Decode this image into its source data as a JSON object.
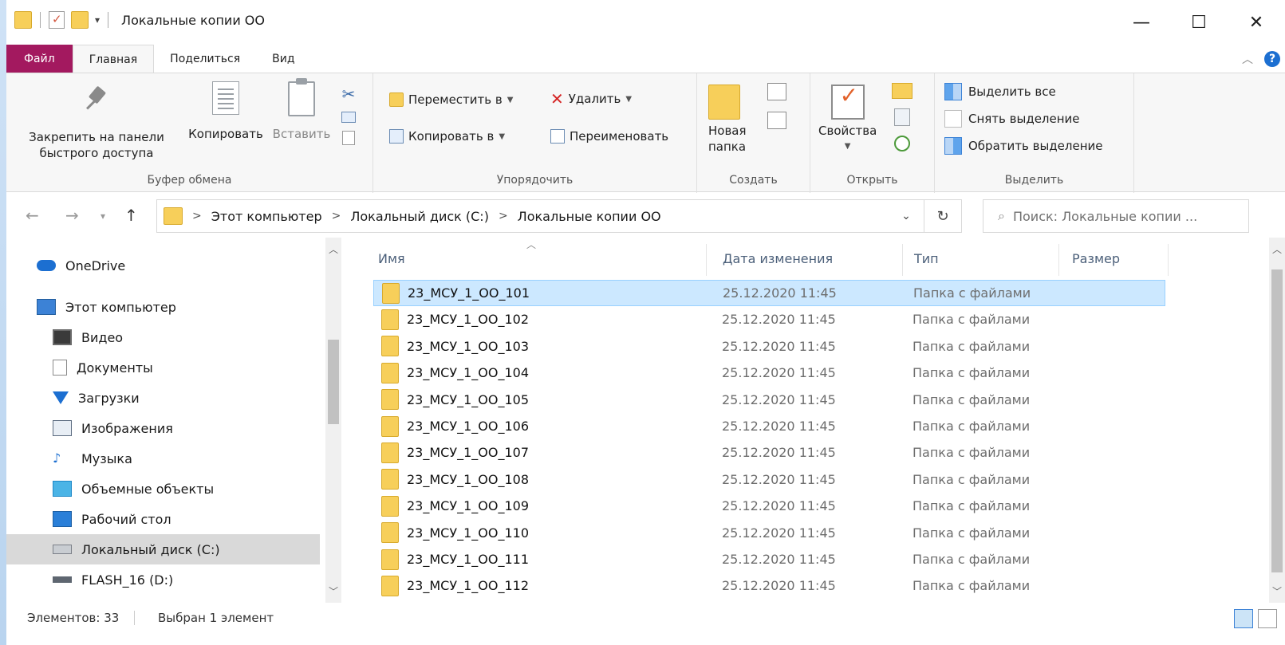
{
  "window": {
    "title": "Локальные копии ОО",
    "controls": {
      "minimize": "—",
      "maximize": "☐",
      "close": "✕"
    }
  },
  "ribbon_tabs": [
    "Файл",
    "Главная",
    "Поделиться",
    "Вид"
  ],
  "ribbon": {
    "clipboard": {
      "label": "Буфер обмена",
      "pin_line1": "Закрепить на панели",
      "pin_line2": "быстрого доступа",
      "copy": "Копировать",
      "paste": "Вставить"
    },
    "organize": {
      "label": "Упорядочить",
      "move_to": "Переместить в",
      "copy_to": "Копировать в",
      "delete": "Удалить",
      "rename": "Переименовать"
    },
    "create": {
      "label": "Создать",
      "new_folder_line1": "Новая",
      "new_folder_line2": "папка"
    },
    "open": {
      "label": "Открыть",
      "properties": "Свойства"
    },
    "select": {
      "label": "Выделить",
      "select_all": "Выделить все",
      "select_none": "Снять выделение",
      "invert": "Обратить выделение"
    }
  },
  "address": {
    "crumbs": [
      "Этот компьютер",
      "Локальный диск (C:)",
      "Локальные копии ОО"
    ],
    "search_placeholder": "Поиск: Локальные копии ..."
  },
  "nav_pane": [
    {
      "label": "OneDrive",
      "icon": "cloud-icon",
      "indent": false
    },
    {
      "label": "Этот компьютер",
      "icon": "computer-icon",
      "indent": false
    },
    {
      "label": "Видео",
      "icon": "video-icon",
      "indent": true
    },
    {
      "label": "Документы",
      "icon": "documents-icon",
      "indent": true
    },
    {
      "label": "Загрузки",
      "icon": "download-icon",
      "indent": true
    },
    {
      "label": "Изображения",
      "icon": "pictures-icon",
      "indent": true
    },
    {
      "label": "Музыка",
      "icon": "music-icon",
      "indent": true
    },
    {
      "label": "Объемные объекты",
      "icon": "3d-objects-icon",
      "indent": true
    },
    {
      "label": "Рабочий стол",
      "icon": "desktop-icon",
      "indent": true
    },
    {
      "label": "Локальный диск (C:)",
      "icon": "local-disk-icon",
      "indent": true,
      "selected": true
    },
    {
      "label": "FLASH_16 (D:)",
      "icon": "usb-drive-icon",
      "indent": true
    }
  ],
  "columns": {
    "name": "Имя",
    "date": "Дата изменения",
    "type": "Тип",
    "size": "Размер"
  },
  "files": [
    {
      "name": "23_МСУ_1_ОО_101",
      "date": "25.12.2020 11:45",
      "type": "Папка с файлами",
      "selected": true
    },
    {
      "name": "23_МСУ_1_ОО_102",
      "date": "25.12.2020 11:45",
      "type": "Папка с файлами"
    },
    {
      "name": "23_МСУ_1_ОО_103",
      "date": "25.12.2020 11:45",
      "type": "Папка с файлами"
    },
    {
      "name": "23_МСУ_1_ОО_104",
      "date": "25.12.2020 11:45",
      "type": "Папка с файлами"
    },
    {
      "name": "23_МСУ_1_ОО_105",
      "date": "25.12.2020 11:45",
      "type": "Папка с файлами"
    },
    {
      "name": "23_МСУ_1_ОО_106",
      "date": "25.12.2020 11:45",
      "type": "Папка с файлами"
    },
    {
      "name": "23_МСУ_1_ОО_107",
      "date": "25.12.2020 11:45",
      "type": "Папка с файлами"
    },
    {
      "name": "23_МСУ_1_ОО_108",
      "date": "25.12.2020 11:45",
      "type": "Папка с файлами"
    },
    {
      "name": "23_МСУ_1_ОО_109",
      "date": "25.12.2020 11:45",
      "type": "Папка с файлами"
    },
    {
      "name": "23_МСУ_1_ОО_110",
      "date": "25.12.2020 11:45",
      "type": "Папка с файлами"
    },
    {
      "name": "23_МСУ_1_ОО_111",
      "date": "25.12.2020 11:45",
      "type": "Папка с файлами"
    },
    {
      "name": "23_МСУ_1_ОО_112",
      "date": "25.12.2020 11:45",
      "type": "Папка с файлами"
    }
  ],
  "status": {
    "items_count": "Элементов: 33",
    "selected": "Выбран 1 элемент"
  },
  "colors": {
    "file_tab": "#a3195f",
    "selection": "#cce8ff",
    "folder": "#f7cf5a"
  }
}
